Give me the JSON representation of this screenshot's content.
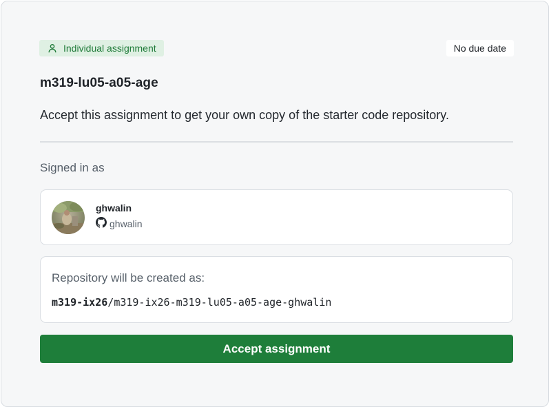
{
  "assignment": {
    "type_label": "Individual assignment",
    "due_label": "No due date",
    "title": "m319-lu05-a05-age",
    "description": "Accept this assignment to get your own copy of the starter code repository."
  },
  "signed_in": {
    "label": "Signed in as",
    "user": {
      "display_name": "ghwalin",
      "username": "ghwalin"
    }
  },
  "repository": {
    "label": "Repository will be created as:",
    "org": "m319-ix26",
    "separator": "/",
    "name": "m319-ix26-m319-lu05-a05-age-ghwalin"
  },
  "actions": {
    "accept_label": "Accept assignment"
  },
  "colors": {
    "accent_green": "#1e7e3a",
    "badge_green_bg": "#dff0e3",
    "badge_green_text": "#1e7a38"
  },
  "icons": {
    "type_badge": "person-icon",
    "username": "github-icon"
  }
}
